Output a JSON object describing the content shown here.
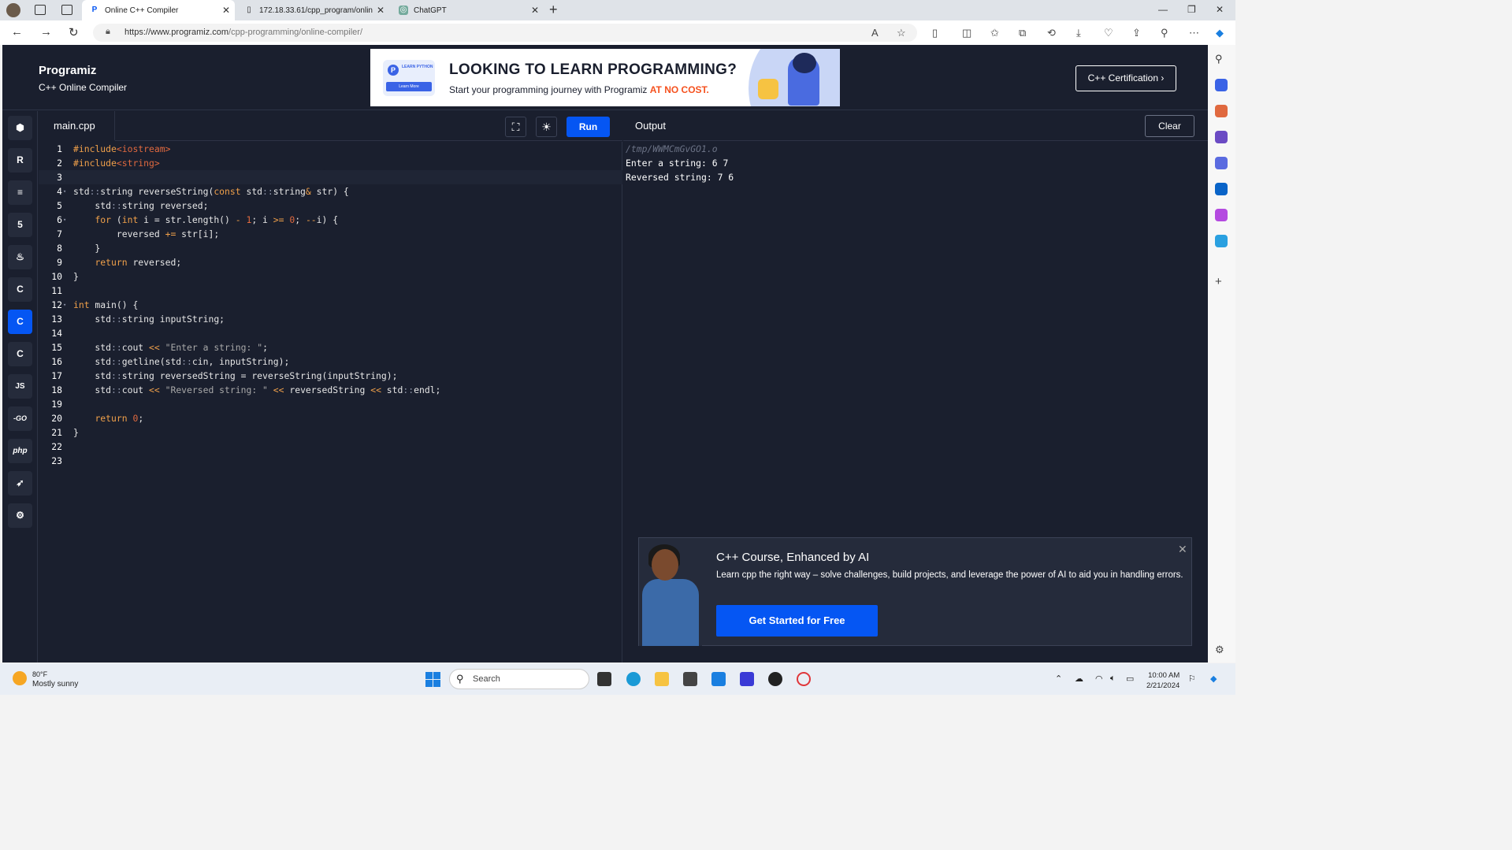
{
  "browser": {
    "tabs": [
      {
        "title": "Online C++ Compiler",
        "active": true
      },
      {
        "title": "172.18.33.61/cpp_program/onlin",
        "active": false
      },
      {
        "title": "ChatGPT",
        "active": false
      }
    ],
    "url_host": "https://www.programiz.com",
    "url_path": "/cpp-programming/online-compiler/"
  },
  "header": {
    "logo": "Programiz",
    "subtitle": "C++ Online Compiler",
    "banner_small": "LEARN PYTHON",
    "banner_button": "Learn More",
    "banner_headline": "LOOKING TO LEARN PROGRAMMING?",
    "banner_sub_prefix": "Start your programming journey with Programiz ",
    "banner_sub_highlight": "AT NO COST.",
    "cert_button": "C++ Certification ›"
  },
  "sidebar": {
    "languages": [
      "python",
      "r",
      "sql",
      "html",
      "java",
      "c",
      "cpp",
      "csharp",
      "js",
      "go",
      "php",
      "swift",
      "rust"
    ],
    "labels": {
      "js": "JS",
      "go": "-GO",
      "php": "php"
    }
  },
  "editor": {
    "file_tab": "main.cpp",
    "run_label": "Run",
    "lines": [
      "#include<iostream>",
      "#include<string>",
      "",
      "std::string reverseString(const std::string& str) {",
      "    std::string reversed;",
      "    for (int i = str.length() - 1; i >= 0; --i) {",
      "        reversed += str[i];",
      "    }",
      "    return reversed;",
      "}",
      "",
      "int main() {",
      "    std::string inputString;",
      "",
      "    std::cout << \"Enter a string: \";",
      "    std::getline(std::cin, inputString);",
      "    std::string reversedString = reverseString(inputString);",
      "    std::cout << \"Reversed string: \" << reversedString << std::endl;",
      "",
      "    return 0;",
      "}",
      "",
      ""
    ]
  },
  "output": {
    "title": "Output",
    "clear_label": "Clear",
    "lines": [
      "/tmp/WWMCmGvGO1.o",
      "Enter a string: 6 7",
      "Reversed string: 7 6"
    ]
  },
  "promo": {
    "title": "C++ Course, Enhanced by AI",
    "description": "Learn cpp the right way – solve challenges, build projects, and leverage the power of AI to aid you in handling errors.",
    "button": "Get Started for Free"
  },
  "taskbar": {
    "temp": "80°F",
    "weather": "Mostly sunny",
    "search": "Search",
    "time": "10:00 AM",
    "date": "2/21/2024"
  },
  "colors": {
    "background": "#1a1f2e",
    "accent": "#0556f3",
    "keyword": "#f0a04a"
  }
}
